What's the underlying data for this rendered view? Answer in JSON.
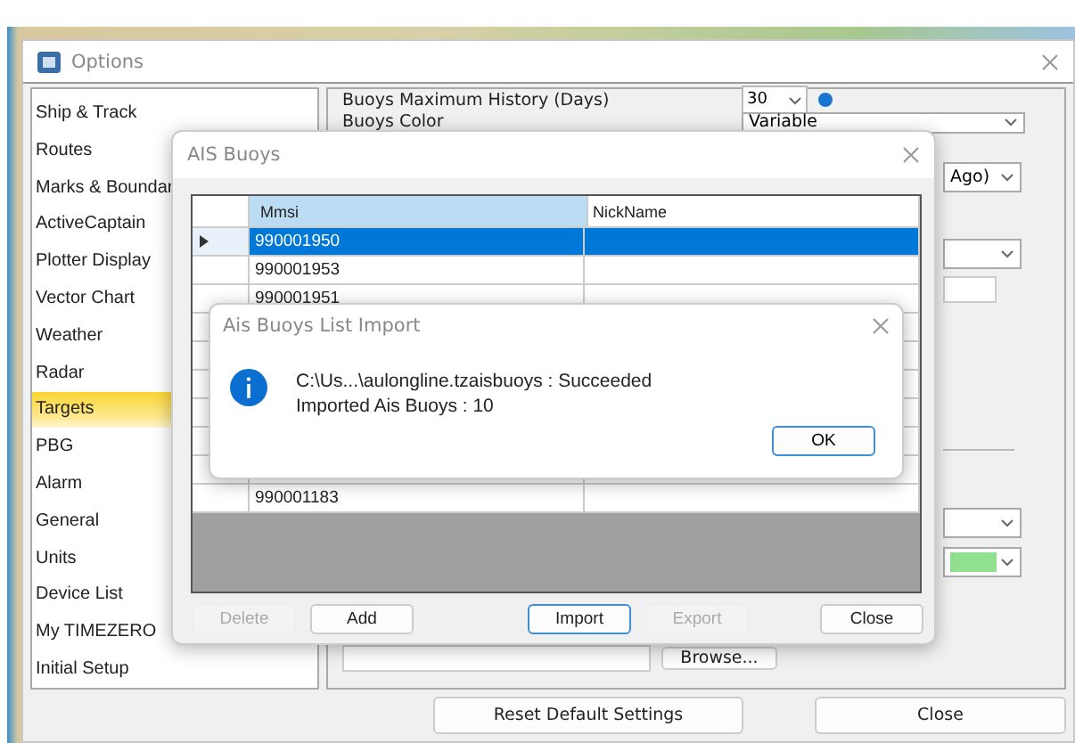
{
  "options_window": {
    "title": "Options",
    "sidebar": {
      "items": [
        {
          "label": "Ship & Track",
          "selected": false
        },
        {
          "label": "Routes",
          "selected": false
        },
        {
          "label": "Marks & Boundar",
          "selected": false
        },
        {
          "label": "ActiveCaptain",
          "selected": false
        },
        {
          "label": "Plotter Display",
          "selected": false
        },
        {
          "label": "Vector Chart",
          "selected": false
        },
        {
          "label": "Weather",
          "selected": false
        },
        {
          "label": "Radar",
          "selected": false
        },
        {
          "label": "Targets",
          "selected": true
        },
        {
          "label": "PBG",
          "selected": false
        },
        {
          "label": "Alarm",
          "selected": false
        },
        {
          "label": "General",
          "selected": false
        },
        {
          "label": "Units",
          "selected": false
        },
        {
          "label": "Device List",
          "selected": false
        },
        {
          "label": "My TIMEZERO",
          "selected": false
        },
        {
          "label": "Initial Setup",
          "selected": false
        }
      ]
    },
    "settings": {
      "history_label": "Buoys Maximum History (Days)",
      "history_value": "30",
      "color_label": "Buoys Color",
      "color_value": "Variable",
      "time_value": "Ago)",
      "browse_button": "Browse..."
    },
    "buttons": [
      "Reset Default Settings",
      "Close"
    ]
  },
  "ais_buoys_dialog": {
    "title": "AIS Buoys",
    "table": {
      "columns": [
        "Mmsi",
        "NickName"
      ],
      "rows": [
        {
          "mmsi": "990001950",
          "selected": true
        },
        {
          "mmsi": "990001953",
          "selected": false
        },
        {
          "mmsi": "990001951",
          "selected": false
        },
        {
          "mmsi": "990001183",
          "selected": false
        }
      ]
    },
    "buttons": [
      {
        "label": "Delete",
        "disabled": true,
        "focused": false
      },
      {
        "label": "Add",
        "disabled": false,
        "focused": false
      },
      {
        "label": "Import",
        "disabled": false,
        "focused": true
      },
      {
        "label": "Export",
        "disabled": true,
        "focused": false
      },
      {
        "label": "Close",
        "disabled": false,
        "focused": false
      }
    ]
  },
  "message_box": {
    "title": "Ais Buoys List Import",
    "lines": [
      "C:\\Us...\\aulongline.tzaisbuoys : Succeeded",
      "Imported Ais Buoys : 10"
    ],
    "button": "OK"
  }
}
